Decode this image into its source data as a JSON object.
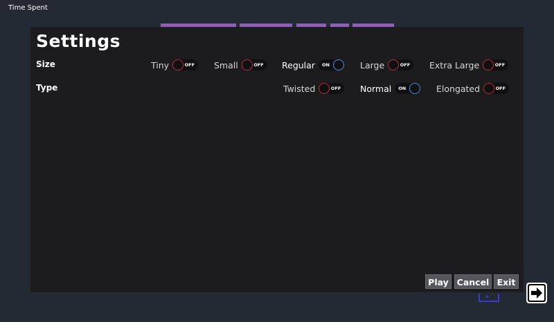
{
  "window": {
    "title": "Time Spent"
  },
  "colors": {
    "accent_purple": "#8e5fb8",
    "toggle_off": "#c22a3e",
    "toggle_on": "#4a8fe8",
    "panel_bg": "#1c1c1f",
    "frame_bg": "#242a33"
  },
  "settings": {
    "title": "Settings",
    "size": {
      "label": "Size",
      "options": [
        {
          "label": "Tiny",
          "state": "OFF"
        },
        {
          "label": "Small",
          "state": "OFF"
        },
        {
          "label": "Regular",
          "state": "ON"
        },
        {
          "label": "Large",
          "state": "OFF"
        },
        {
          "label": "Extra Large",
          "state": "OFF"
        }
      ]
    },
    "type": {
      "label": "Type",
      "options": [
        {
          "label": "Twisted",
          "state": "OFF"
        },
        {
          "label": "Normal",
          "state": "ON"
        },
        {
          "label": "Elongated",
          "state": "OFF"
        }
      ]
    }
  },
  "buttons": {
    "play": "Play",
    "cancel": "Cancel",
    "exit": "Exit"
  },
  "icons": {
    "next": "arrow-right-icon",
    "back": "back-arrow-icon"
  }
}
